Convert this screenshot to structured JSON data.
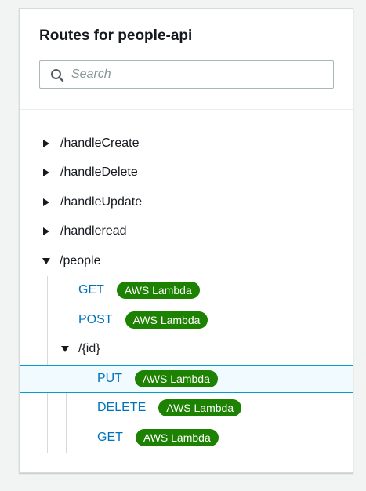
{
  "panel": {
    "title": "Routes for people-api",
    "search": {
      "placeholder": "Search",
      "value": "",
      "icon": "search-icon"
    }
  },
  "routes": {
    "handleCreate": "/handleCreate",
    "handleDelete": "/handleDelete",
    "handleUpdate": "/handleUpdate",
    "handleread": "/handleread",
    "people": {
      "label": "/people",
      "expanded": true,
      "get_method": "GET",
      "get_integration": "AWS Lambda",
      "post_method": "POST",
      "post_integration": "AWS Lambda",
      "id": {
        "label": "/{id}",
        "expanded": true,
        "put_method": "PUT",
        "put_integration": "AWS Lambda",
        "delete_method": "DELETE",
        "delete_integration": "AWS Lambda",
        "get_method": "GET",
        "get_integration": "AWS Lambda"
      }
    }
  },
  "colors": {
    "method_link": "#0073bb",
    "badge_bg": "#1d8102",
    "selection_bg": "#f1faff",
    "selection_border": "#00a1c9"
  }
}
